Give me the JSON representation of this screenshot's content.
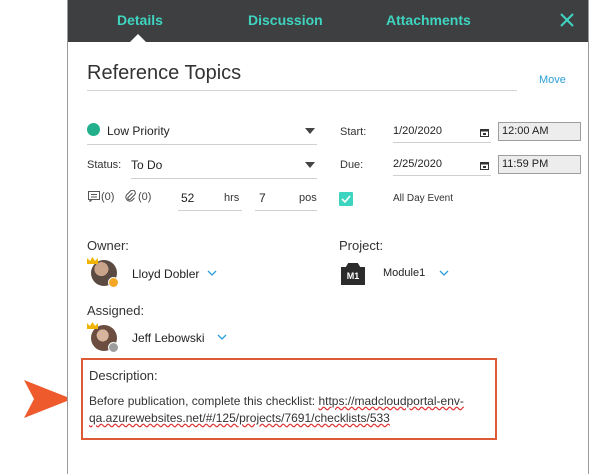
{
  "tabs": {
    "details": "Details",
    "discussion": "Discussion",
    "attachments": "Attachments"
  },
  "task": {
    "title": "Reference Topics",
    "move_label": "Move"
  },
  "fields": {
    "priority": "Low Priority",
    "status_label": "Status:",
    "status_value": "To Do",
    "start_label": "Start:",
    "start_date": "1/20/2020",
    "start_time": "12:00 AM",
    "due_label": "Due:",
    "due_date": "2/25/2020",
    "due_time": "11:59 PM",
    "discussion_count": "(0)",
    "attachment_count": "(0)",
    "hours_value": "52",
    "hours_unit": "hrs",
    "pos_value": "7",
    "pos_unit": "pos",
    "all_day_label": "All Day Event",
    "all_day_checked": true
  },
  "owner": {
    "label": "Owner:",
    "name": "Lloyd Dobler"
  },
  "project": {
    "label": "Project:",
    "icon_text": "M1",
    "name": "Module1"
  },
  "assigned": {
    "label": "Assigned:",
    "name": "Jeff Lebowski"
  },
  "description": {
    "label": "Description:",
    "text_prefix": "Before publication, complete this checklist: ",
    "link_text": "https://madcloudportal-env-qa.azurewebsites.net/#/125/projects/7691/checklists/533"
  },
  "colors": {
    "accent": "#3ed5c0",
    "header_bg": "#3e3f41",
    "priority_dot": "#22b08c",
    "callout": "#dd5a36",
    "owner_status": "#f5a623",
    "assigned_status": "#9e9e9e"
  }
}
